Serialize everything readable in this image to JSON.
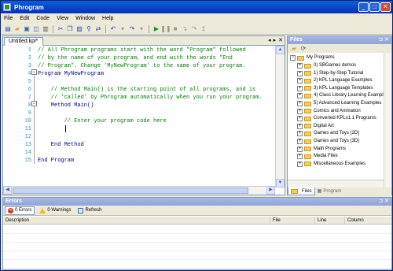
{
  "window": {
    "title": "Phrogram",
    "min": "_",
    "max": "□",
    "close": "✕"
  },
  "menu": [
    "File",
    "Edit",
    "Code",
    "View",
    "Window",
    "Help"
  ],
  "editor": {
    "tab_label": "Untitled.kpl*",
    "tab_prev": "◂",
    "tab_next": "▸",
    "tab_close": "✕",
    "lines": [
      {
        "n": "1",
        "text": "// All Phrogram programs start with the word \"Program\" followed",
        "cls": "cm"
      },
      {
        "n": "2",
        "text": "// by the name of your program, and end with the words \"End",
        "cls": "cm"
      },
      {
        "n": "3",
        "text": "// Program\". Change 'MyNewProgram' to the name of your program.",
        "cls": "cm"
      },
      {
        "n": "4",
        "text": "Program MyNewProgram",
        "cls": "kw"
      },
      {
        "n": "5",
        "text": "",
        "cls": ""
      },
      {
        "n": "6",
        "text": "    // Method Main() is the starting point of all programs, and is",
        "cls": "cm"
      },
      {
        "n": "7",
        "text": "    // 'called' by Phrogram automatically when you run your program.",
        "cls": "cm"
      },
      {
        "n": "8",
        "text": "    Method Main()",
        "cls": "kw"
      },
      {
        "n": "9",
        "text": "",
        "cls": ""
      },
      {
        "n": "10",
        "text": "        // Enter your program code here",
        "cls": "cm"
      },
      {
        "n": "11",
        "text": "",
        "cls": ""
      },
      {
        "n": "12",
        "text": "",
        "cls": ""
      },
      {
        "n": "13",
        "text": "    End Method",
        "cls": "kw"
      },
      {
        "n": "14",
        "text": "",
        "cls": ""
      },
      {
        "n": "15",
        "text": "End Program",
        "cls": "kw"
      }
    ]
  },
  "files": {
    "title": "Files",
    "pin": "⊐",
    "close": "✕",
    "root": "My Programs",
    "items": [
      "0) SBGames demos",
      "1) Step-by-Step Tutorial",
      "2) KPL Language Examples",
      "3) KPL Language Templates",
      "4) Class Library Learning Examples",
      "5) Advanced Learning Examples",
      "Comics and Animation",
      "Converted KPLv1.1 Programs",
      "Digital Art",
      "Games and Toys (2D)",
      "Games and Toys (3D)",
      "Math Programs",
      "Media Files",
      "Miscellaneous Examples"
    ],
    "tabs": [
      "Files",
      "Program"
    ]
  },
  "errors": {
    "title": "Errors",
    "pin": "⊐",
    "close": "✕",
    "errors_label": "0 Errors",
    "warnings_label": "0 Warnings",
    "refresh_label": "Refresh",
    "columns": [
      "Description",
      "File",
      "Line",
      "Column"
    ]
  }
}
